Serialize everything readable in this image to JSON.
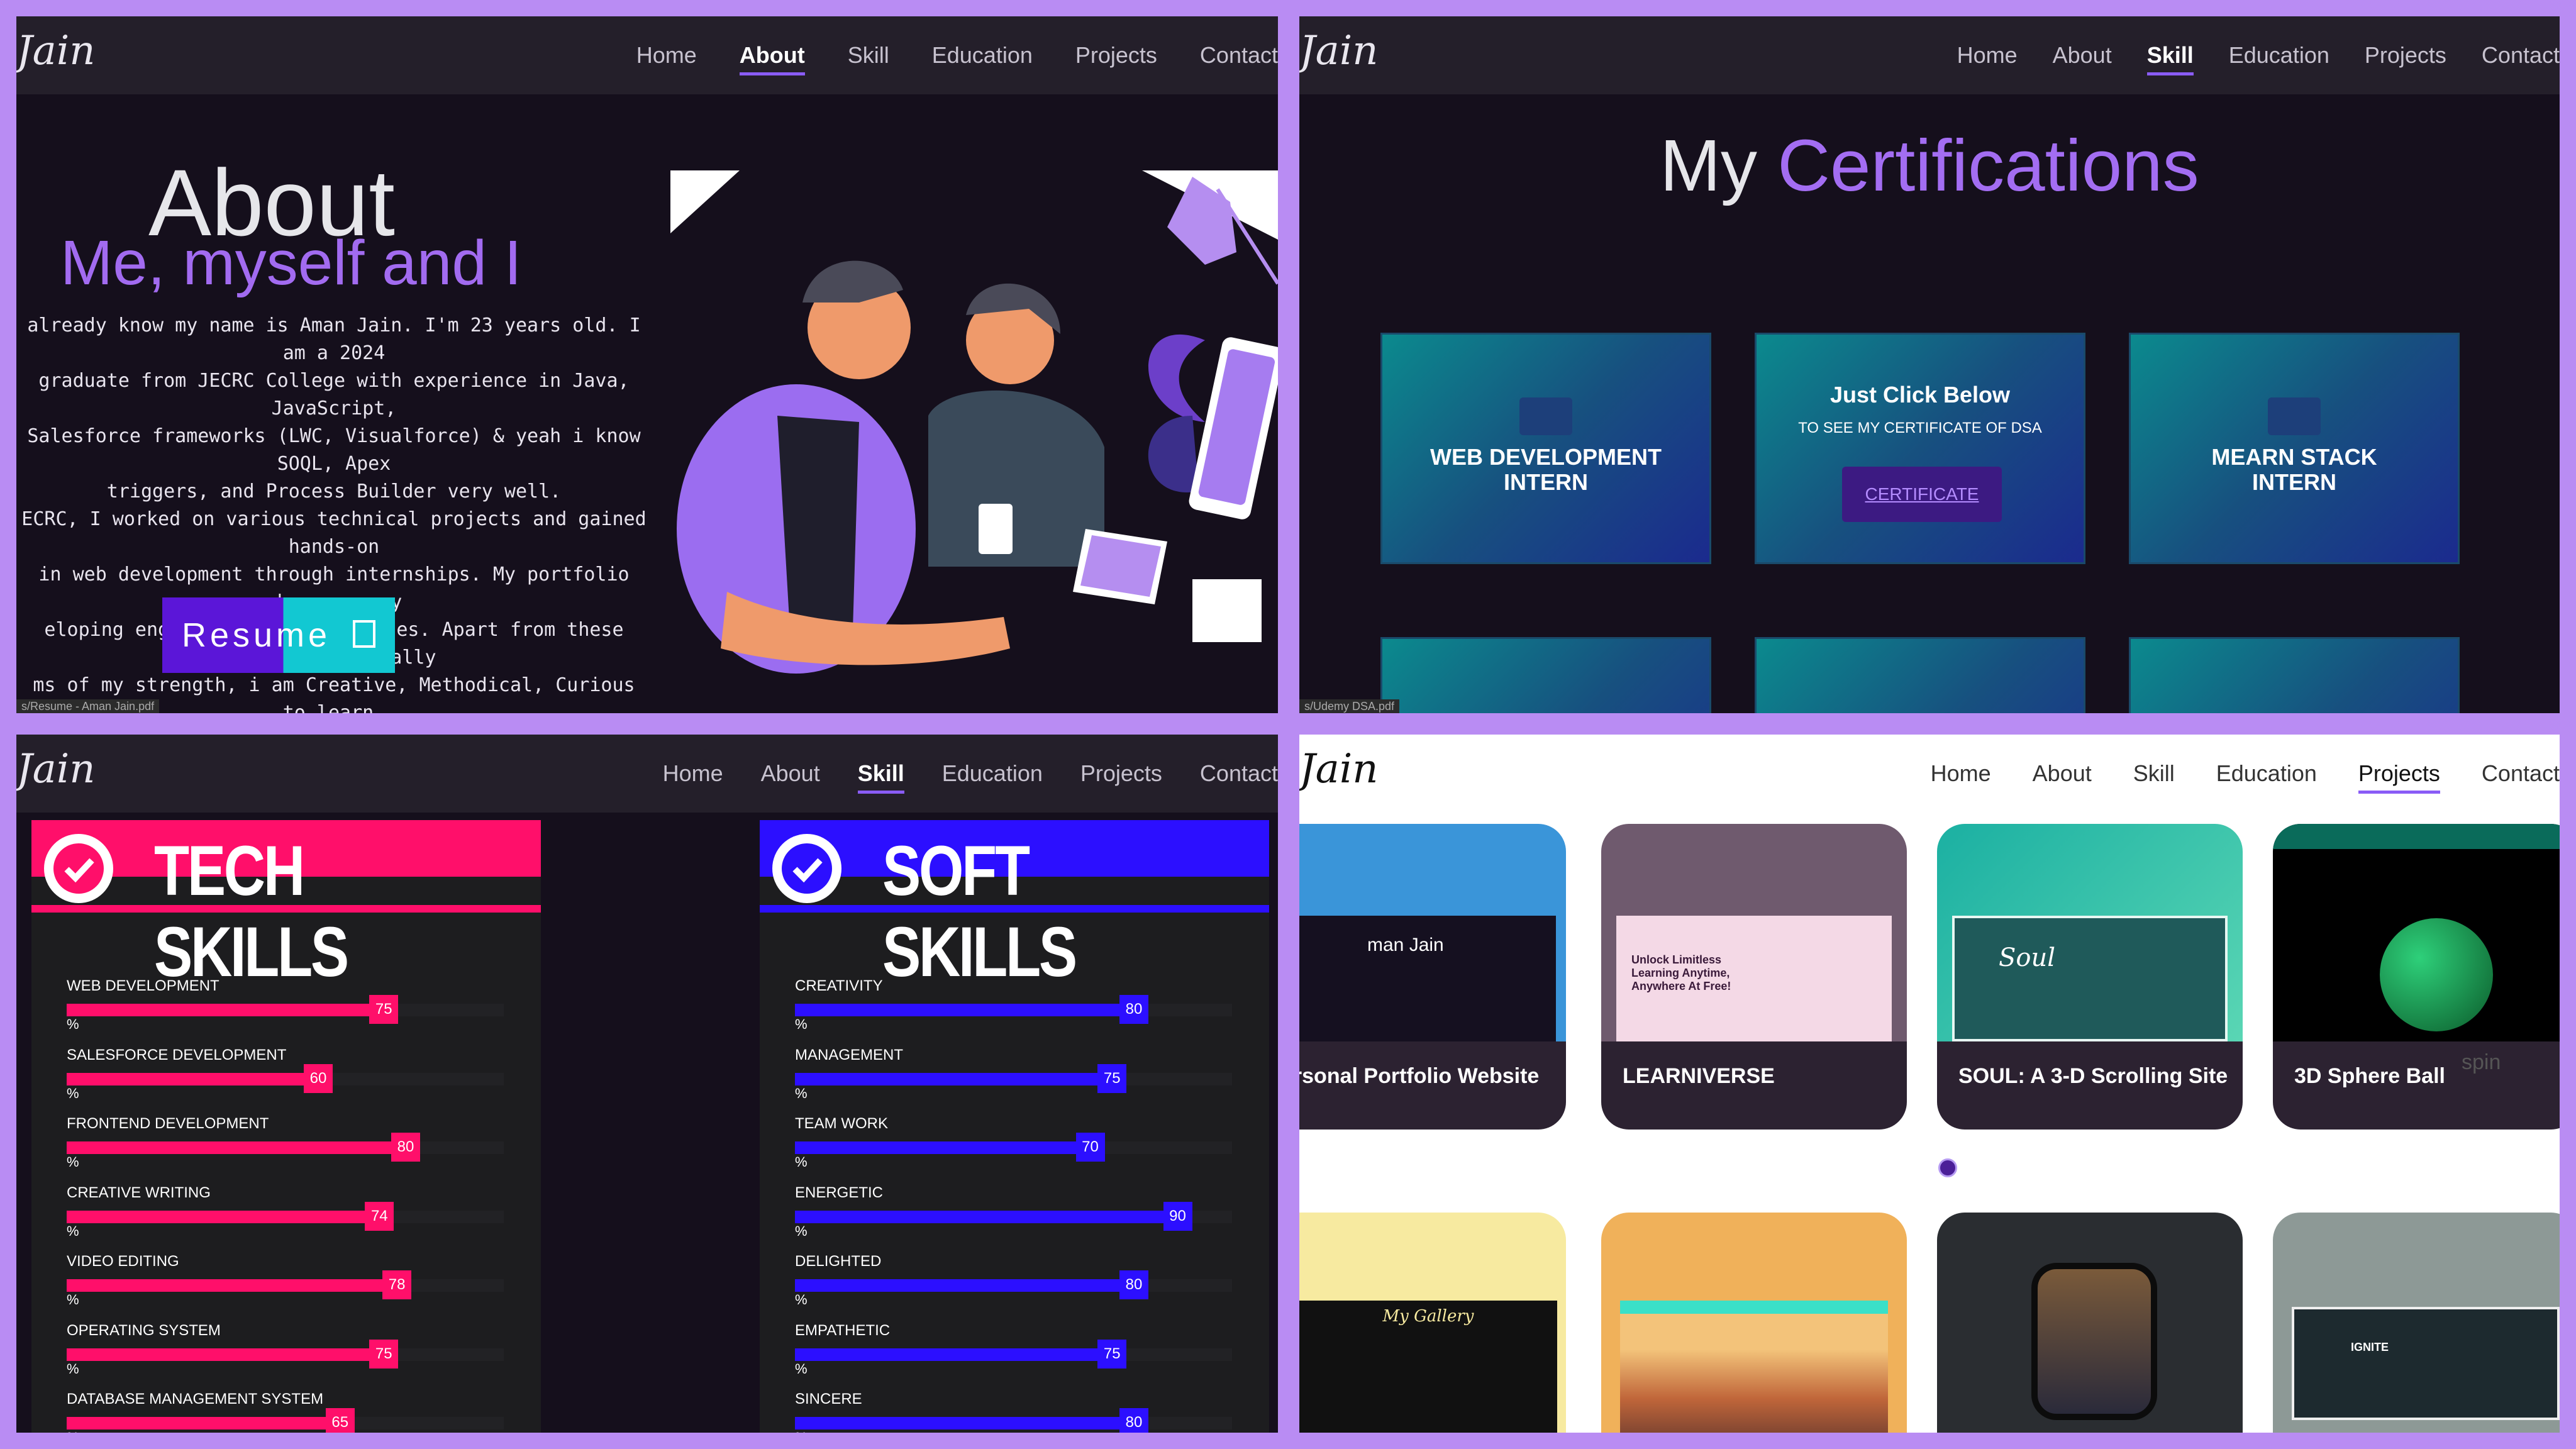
{
  "nav": {
    "logo": "Jain",
    "items": [
      "Home",
      "About",
      "Skill",
      "Education",
      "Projects",
      "Contact"
    ]
  },
  "about": {
    "title": "About",
    "subtitle": "Me, myself and I",
    "text": "already know my name is Aman Jain. I'm 23 years old. I am a 2024\n graduate from JECRC College with experience in Java, JavaScript,\nSalesforce frameworks (LWC, Visualforce) & yeah i know SOQL, Apex\ntriggers, and Process Builder very well.\nECRC, I worked on various technical projects and gained hands-on\n in web development through internships. My portfolio showcases my\neloping engaging user experiences. Apart from these skills, Personally\nms of my strength, i am Creative, Methodical, Curious to learn,\nHardworking, good in management and designing.",
    "resume_label": "Resume",
    "status": "s/Resume - Aman Jain.pdf"
  },
  "certifications": {
    "title_plain": "My",
    "title_accent": "Certifications",
    "cards": [
      {
        "title": "WEB DEVELOPMENT\nINTERN"
      },
      {
        "heading": "Just Click Below",
        "sub": "TO SEE MY CERTIFICATE OF DSA",
        "button": "CERTIFICATE"
      },
      {
        "title": "MEARN STACK\nINTERN"
      }
    ],
    "status": "s/Udemy DSA.pdf"
  },
  "skills": {
    "tech": {
      "title": "TECH SKILLS",
      "color": "#ff0f6a",
      "items": [
        {
          "label": "WEB DEVELOPMENT",
          "value": 75
        },
        {
          "label": "SALESFORCE DEVELOPMENT",
          "value": 60
        },
        {
          "label": "FRONTEND DEVELOPMENT",
          "value": 80
        },
        {
          "label": "CREATIVE WRITING",
          "value": 74
        },
        {
          "label": "VIDEO EDITING",
          "value": 78
        },
        {
          "label": "OPERATING SYSTEM",
          "value": 75
        },
        {
          "label": "DATABASE MANAGEMENT SYSTEM",
          "value": 65
        }
      ]
    },
    "soft": {
      "title": "SOFT SKILLS",
      "color": "#2c0fff",
      "items": [
        {
          "label": "CREATIVITY",
          "value": 80
        },
        {
          "label": "MANAGEMENT",
          "value": 75
        },
        {
          "label": "TEAM WORK",
          "value": 70
        },
        {
          "label": "ENERGETIC",
          "value": 90
        },
        {
          "label": "DELIGHTED",
          "value": 80
        },
        {
          "label": "EMPATHETIC",
          "value": 75
        },
        {
          "label": "SINCERE",
          "value": 80
        }
      ]
    },
    "percent_sign": "%"
  },
  "projects": {
    "cards": [
      {
        "name": "ersonal Portfolio Website",
        "bg": "#3a95d9",
        "preview": "man Jain"
      },
      {
        "name": "LEARNIVERSE",
        "bg": "#6f5a6e",
        "preview": "Unlock Limitless Learning Anytime, Anywhere At Free!"
      },
      {
        "name": "SOUL: A 3-D Scrolling Site",
        "bg": "#1bb0a2",
        "preview": "Soul"
      },
      {
        "name": "3D Sphere Ball",
        "bg": "#0a6b5a",
        "preview": "spin"
      }
    ],
    "bottom_cards": [
      {
        "bg": "#f7eaa0",
        "preview": "My Gallery"
      },
      {
        "bg": "#f0b15a",
        "preview": ""
      },
      {
        "bg": "#2a2d31",
        "preview": ""
      },
      {
        "bg": "#8d9996",
        "preview": "IGNITE"
      }
    ]
  }
}
